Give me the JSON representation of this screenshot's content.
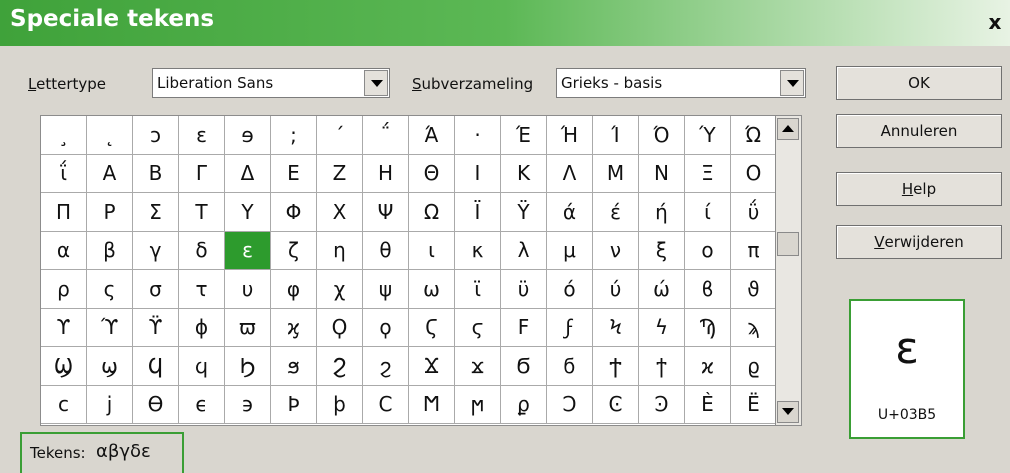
{
  "dialog": {
    "title": "Speciale tekens",
    "close_label": "x"
  },
  "font": {
    "label_accel": "L",
    "label_rest": "ettertype",
    "value": "Liberation Sans"
  },
  "subset": {
    "label_accel": "S",
    "label_rest": "ubverzameling",
    "value": "Grieks - basis"
  },
  "grid": {
    "selected_index": 52,
    "characters": [
      "¸",
      "˛",
      "ɔ",
      "ɛ",
      "ɘ",
      ";",
      "΄",
      "΅",
      "Ά",
      "·",
      "Έ",
      "Ή",
      "Ί",
      "Ό",
      "Ύ",
      "Ώ",
      "ΐ",
      "Α",
      "Β",
      "Γ",
      "Δ",
      "Ε",
      "Ζ",
      "Η",
      "Θ",
      "Ι",
      "Κ",
      "Λ",
      "Μ",
      "Ν",
      "Ξ",
      "Ο",
      "Π",
      "Ρ",
      "Σ",
      "Τ",
      "Υ",
      "Φ",
      "Χ",
      "Ψ",
      "Ω",
      "Ϊ",
      "Ϋ",
      "ά",
      "έ",
      "ή",
      "ί",
      "ΰ",
      "α",
      "β",
      "γ",
      "δ",
      "ε",
      "ζ",
      "η",
      "θ",
      "ι",
      "κ",
      "λ",
      "μ",
      "ν",
      "ξ",
      "ο",
      "π",
      "ρ",
      "ς",
      "σ",
      "τ",
      "υ",
      "φ",
      "χ",
      "ψ",
      "ω",
      "ϊ",
      "ϋ",
      "ό",
      "ύ",
      "ώ",
      "ϐ",
      "ϑ",
      "ϒ",
      "ϓ",
      "ϔ",
      "ϕ",
      "ϖ",
      "ϗ",
      "Ϙ",
      "ϙ",
      "Ϛ",
      "ϛ",
      "Ϝ",
      "ϝ",
      "Ϟ",
      "ϟ",
      "Ϡ",
      "ϡ",
      "Ϣ",
      "ϣ",
      "Ϥ",
      "ϥ",
      "Ϧ",
      "ϧ",
      "Ϩ",
      "ϩ",
      "Ϫ",
      "ϫ",
      "Ϭ",
      "ϭ",
      "Ϯ",
      "ϯ",
      "ϰ",
      "ϱ",
      "c",
      "j",
      "ϴ",
      "ϵ",
      "϶",
      "Ϸ",
      "ϸ",
      "Ϲ",
      "Ϻ",
      "ϻ",
      "ϼ",
      "Ͻ",
      "Ͼ",
      "Ͽ",
      "Ѐ",
      "Ё"
    ]
  },
  "buttons": {
    "ok": "OK",
    "cancel": "Annuleren",
    "help_accel": "H",
    "help_rest": "elp",
    "delete_accel": "V",
    "delete_rest": "erwijderen"
  },
  "preview": {
    "character": "ε",
    "code": "U+03B5"
  },
  "characters_field": {
    "label": "Tekens:",
    "value": "αβγδε"
  }
}
